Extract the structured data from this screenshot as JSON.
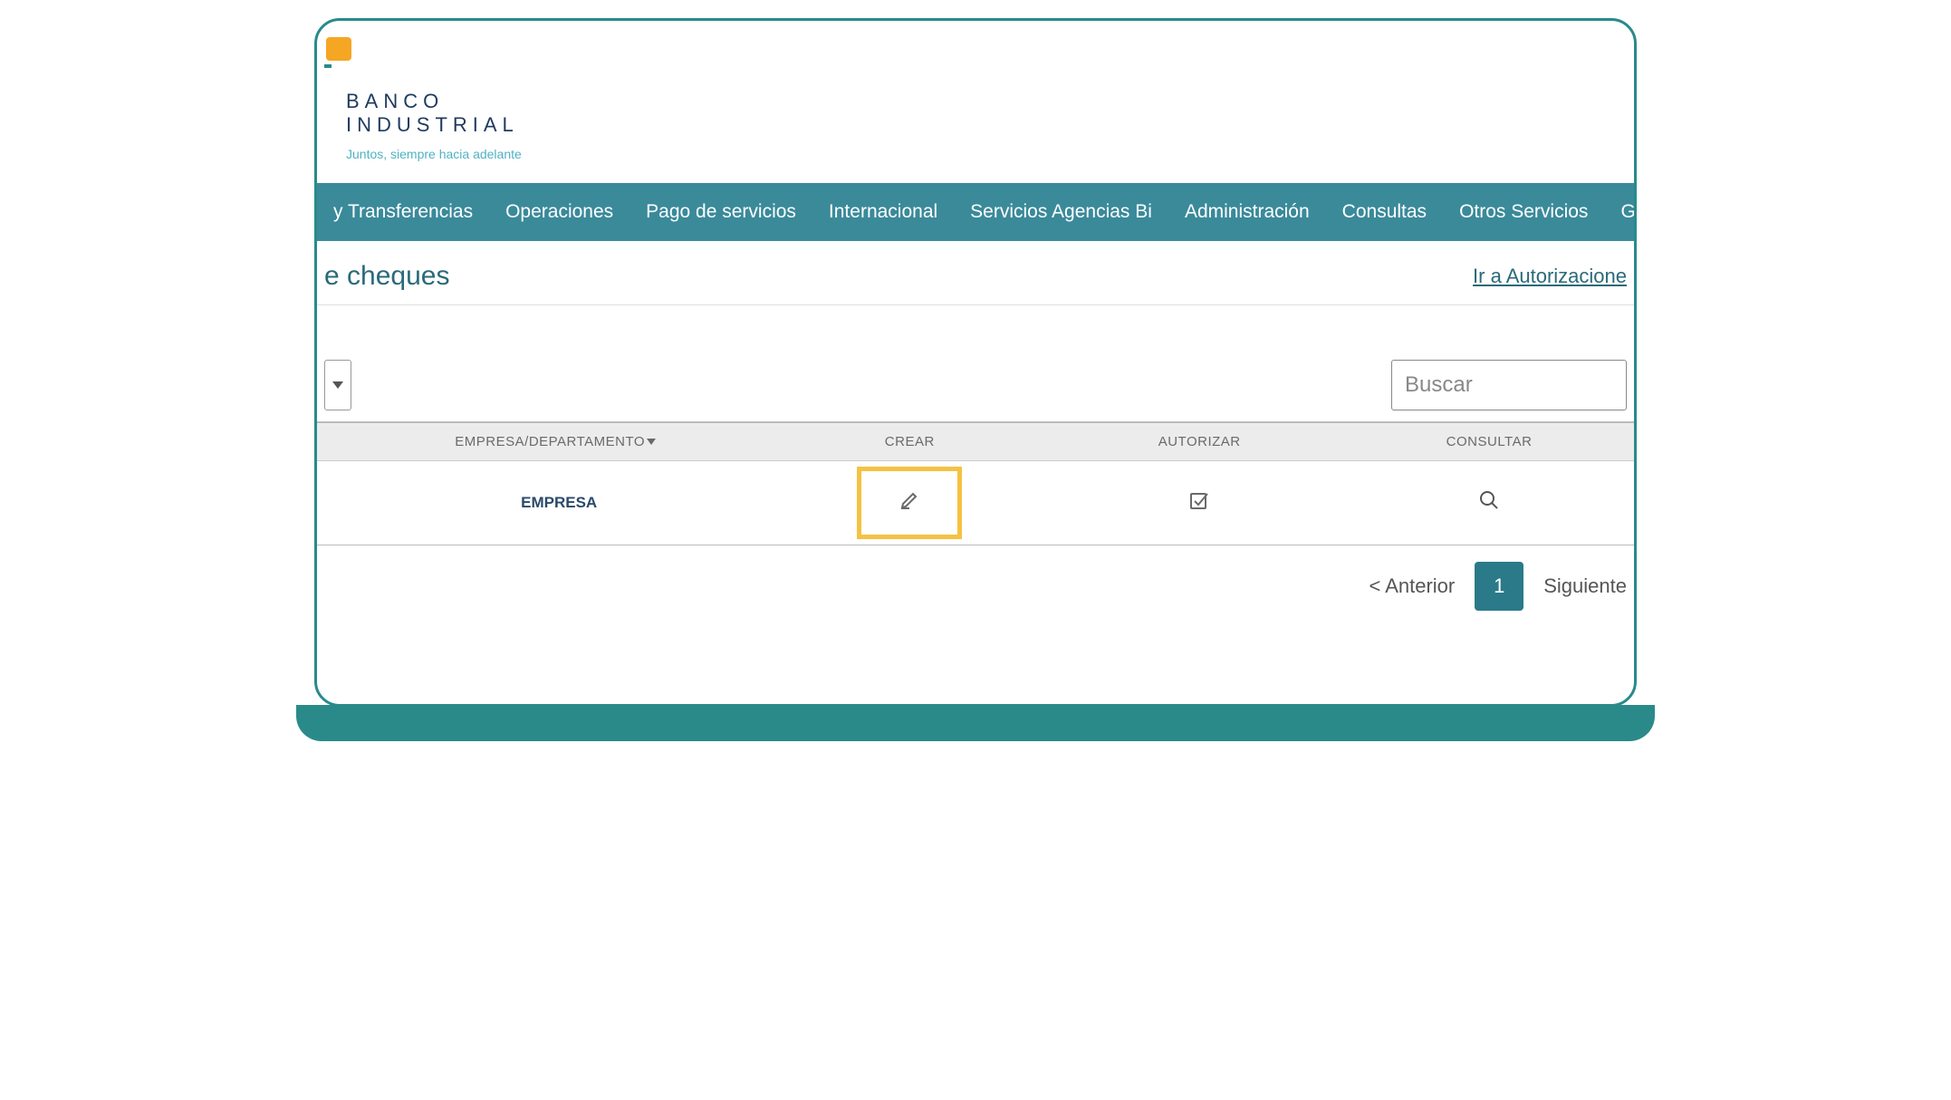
{
  "brand": {
    "line1": "BANCO",
    "line2": "INDUSTRIAL",
    "tagline": "Juntos, siempre hacia adelante"
  },
  "nav": {
    "items": [
      "y Transferencias",
      "Operaciones",
      "Pago de servicios",
      "Internacional",
      "Servicios Agencias Bi",
      "Administración",
      "Consultas",
      "Otros Servicios",
      "Ge"
    ]
  },
  "page": {
    "title_fragment": "e cheques",
    "auth_link": "Ir a Autorizacione"
  },
  "search": {
    "placeholder": "Buscar"
  },
  "table": {
    "headers": {
      "col1": "EMPRESA/DEPARTAMENTO",
      "col2": "CREAR",
      "col3": "AUTORIZAR",
      "col4": "CONSULTAR"
    },
    "rows": [
      {
        "label": "EMPRESA"
      }
    ]
  },
  "pagination": {
    "prev": "< Anterior",
    "current": "1",
    "next": "Siguiente"
  }
}
